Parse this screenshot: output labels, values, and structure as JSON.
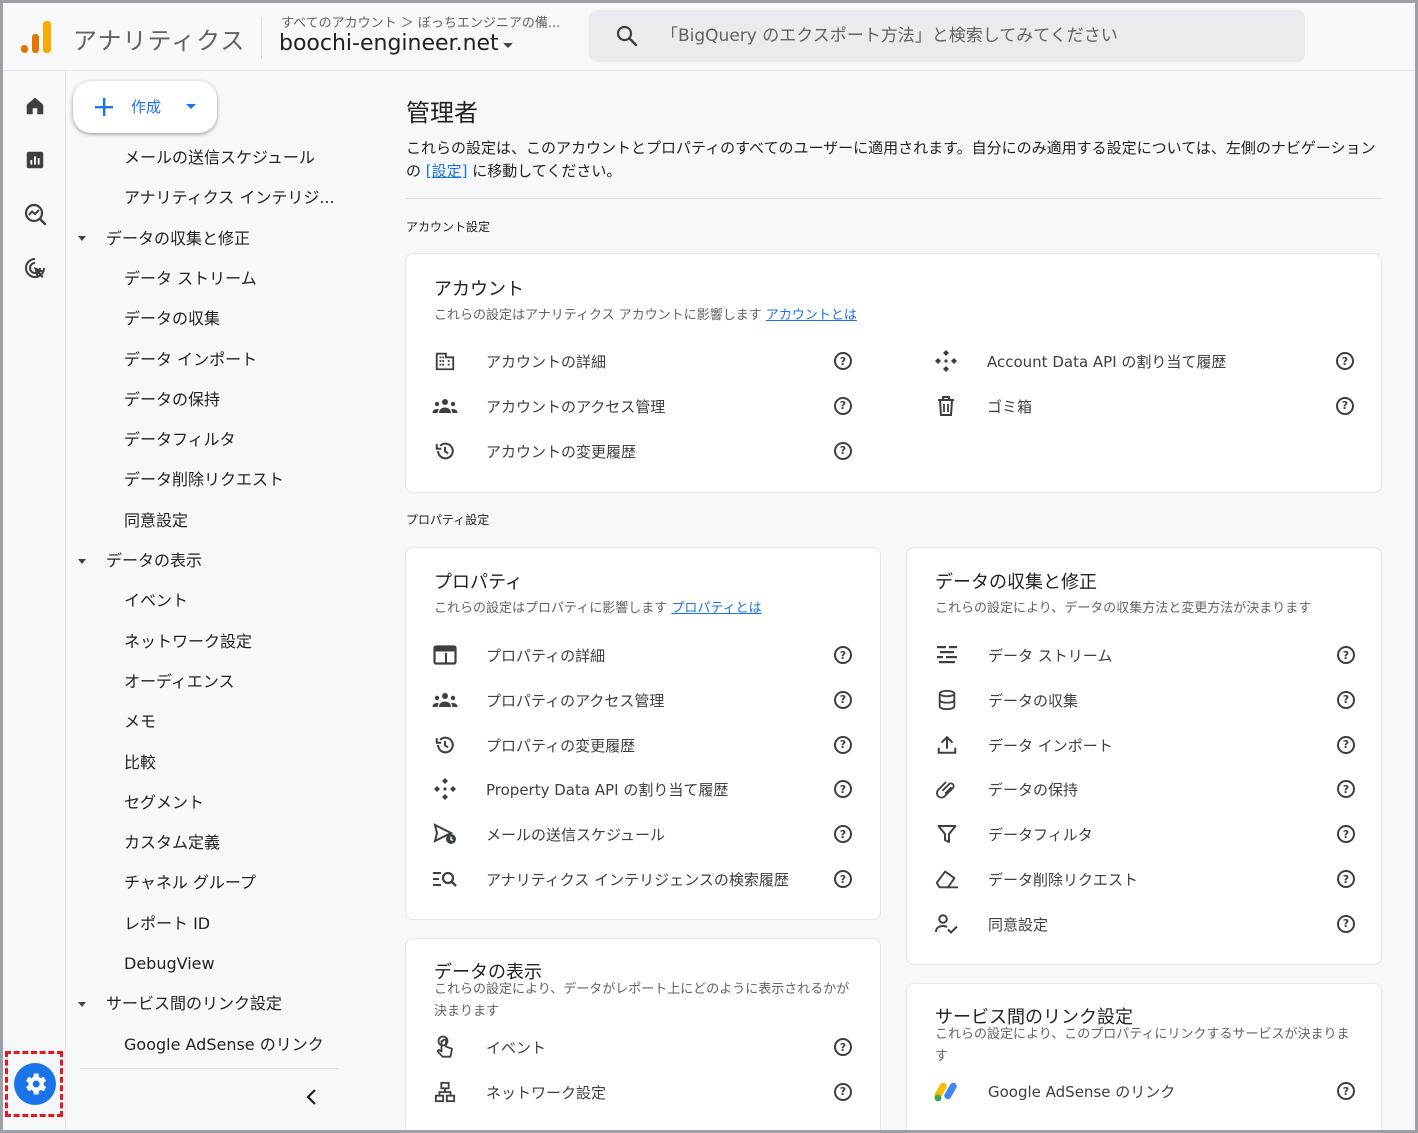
{
  "header": {
    "app_title": "アナリティクス",
    "breadcrumb_top": "すべてのアカウント ＞ ぼっちエンジニアの備...",
    "property_name": "boochi-engineer.net",
    "search_placeholder": "「BigQuery のエクスポート方法」と検索してみてください"
  },
  "rail": {
    "items": [
      "home-icon",
      "reports-icon",
      "explore-icon",
      "advertising-icon"
    ],
    "settings_icon": "gear-icon"
  },
  "leftnav": {
    "create_label": "作成",
    "items": [
      {
        "type": "item",
        "label": "メールの送信スケジュール"
      },
      {
        "type": "item",
        "label": "アナリティクス インテリジ..."
      },
      {
        "type": "group",
        "label": "データの収集と修正"
      },
      {
        "type": "item",
        "label": "データ ストリーム"
      },
      {
        "type": "item",
        "label": "データの収集"
      },
      {
        "type": "item",
        "label": "データ インポート"
      },
      {
        "type": "item",
        "label": "データの保持"
      },
      {
        "type": "item",
        "label": "データフィルタ"
      },
      {
        "type": "item",
        "label": "データ削除リクエスト"
      },
      {
        "type": "item",
        "label": "同意設定"
      },
      {
        "type": "group",
        "label": "データの表示"
      },
      {
        "type": "item",
        "label": "イベント"
      },
      {
        "type": "item",
        "label": "ネットワーク設定"
      },
      {
        "type": "item",
        "label": "オーディエンス"
      },
      {
        "type": "item",
        "label": "メモ"
      },
      {
        "type": "item",
        "label": "比較"
      },
      {
        "type": "item",
        "label": "セグメント"
      },
      {
        "type": "item",
        "label": "カスタム定義"
      },
      {
        "type": "item",
        "label": "チャネル グループ"
      },
      {
        "type": "item",
        "label": "レポート ID"
      },
      {
        "type": "item",
        "label": "DebugView"
      },
      {
        "type": "group",
        "label": "サービス間のリンク設定"
      },
      {
        "type": "item",
        "label": "Google AdSense のリンク"
      }
    ]
  },
  "main": {
    "title": "管理者",
    "desc_before": "これらの設定は、このアカウントとプロパティのすべてのユーザーに適用されます。自分にのみ適用する設定については、左側のナビゲーションの ",
    "desc_link": "[設定]",
    "desc_after": " に移動してください。",
    "account_section_label": "アカウント設定",
    "property_section_label": "プロパティ設定",
    "account_card": {
      "title": "アカウント",
      "sub": "これらの設定はアナリティクス アカウントに影響します",
      "sub_link": "アカウントとは",
      "left_rows": [
        {
          "icon": "building-icon",
          "label": "アカウントの詳細"
        },
        {
          "icon": "people-icon",
          "label": "アカウントのアクセス管理"
        },
        {
          "icon": "history-icon",
          "label": "アカウントの変更履歴"
        }
      ],
      "right_rows": [
        {
          "icon": "api-icon",
          "label": "Account Data API の割り当て履歴"
        },
        {
          "icon": "trash-icon",
          "label": "ゴミ箱"
        }
      ]
    },
    "property_card": {
      "title": "プロパティ",
      "sub": "これらの設定はプロパティに影響します",
      "sub_link": "プロパティとは",
      "rows": [
        {
          "icon": "property-details-icon",
          "label": "プロパティの詳細"
        },
        {
          "icon": "people-icon",
          "label": "プロパティのアクセス管理"
        },
        {
          "icon": "history-icon",
          "label": "プロパティの変更履歴"
        },
        {
          "icon": "api-icon",
          "label": "Property Data API の割り当て履歴"
        },
        {
          "icon": "schedule-send-icon",
          "label": "メールの送信スケジュール"
        },
        {
          "icon": "search-history-icon",
          "label": "アナリティクス インテリジェンスの検索履歴"
        }
      ]
    },
    "data_collection_card": {
      "title": "データの収集と修正",
      "sub": "これらの設定により、データの収集方法と変更方法が決まります",
      "rows": [
        {
          "icon": "stream-icon",
          "label": "データ ストリーム"
        },
        {
          "icon": "database-icon",
          "label": "データの収集"
        },
        {
          "icon": "upload-icon",
          "label": "データ インポート"
        },
        {
          "icon": "retention-icon",
          "label": "データの保持"
        },
        {
          "icon": "filter-icon",
          "label": "データフィルタ"
        },
        {
          "icon": "eraser-icon",
          "label": "データ削除リクエスト"
        },
        {
          "icon": "consent-icon",
          "label": "同意設定"
        }
      ]
    },
    "data_display_card": {
      "title": "データの表示",
      "sub": "これらの設定により、データがレポート上にどのように表示されるかが決まります",
      "rows": [
        {
          "icon": "touch-icon",
          "label": "イベント"
        },
        {
          "icon": "network-icon",
          "label": "ネットワーク設定"
        }
      ]
    },
    "links_card": {
      "title": "サービス間のリンク設定",
      "sub": "これらの設定により、このプロパティにリンクするサービスが決まります",
      "rows": [
        {
          "icon": "adsense-icon",
          "label": "Google AdSense のリンク"
        }
      ]
    }
  }
}
